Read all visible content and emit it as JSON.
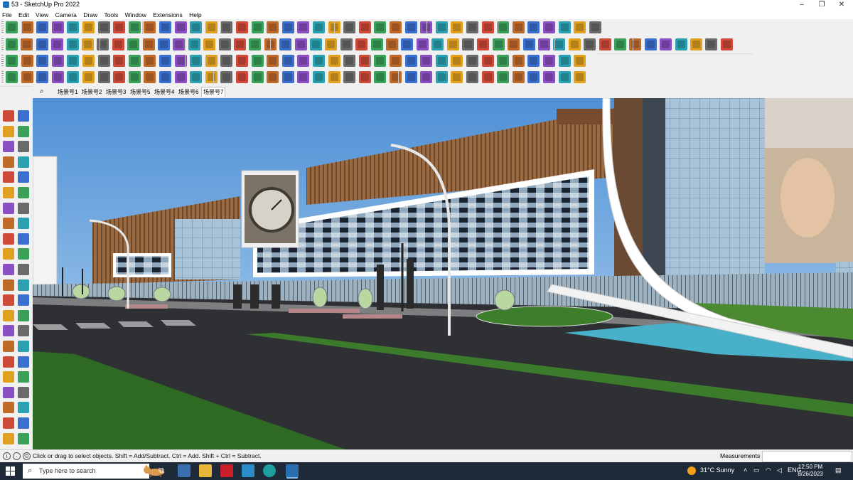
{
  "window": {
    "title": "53 - SketchUp Pro 2022",
    "minimize": "–",
    "maximize": "❐",
    "close": "✕"
  },
  "menu": [
    "File",
    "Edit",
    "View",
    "Camera",
    "Draw",
    "Tools",
    "Window",
    "Extensions",
    "Help"
  ],
  "scenes": {
    "tabs": [
      "场景号1",
      "场景号2",
      "场景号3",
      "场景号5",
      "场景号4",
      "场景号6",
      "场景号7"
    ],
    "active_index": 6
  },
  "status": {
    "hint": "Click or drag to select objects. Shift = Add/Subtract. Ctrl = Add. Shift + Ctrl = Subtract.",
    "measurements_label": "Measurements",
    "measurements_value": ""
  },
  "taskbar": {
    "search_placeholder": "Type here to search",
    "weather": "31°C  Sunny",
    "language": "ENG",
    "time": "12:50 PM",
    "date": "8/26/2023"
  },
  "icons": {
    "toolbar_palette": [
      "#d04a3a",
      "#3a6fd0",
      "#e0a020",
      "#3aa05a",
      "#8a4fc0",
      "#6a6a6a",
      "#c06a2a",
      "#2aa0b0"
    ]
  }
}
